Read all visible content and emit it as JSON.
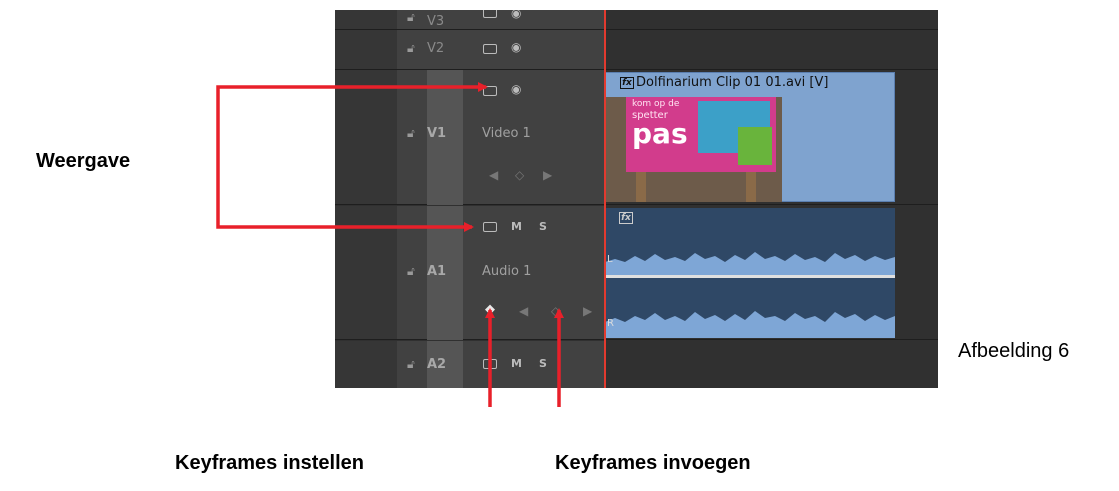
{
  "labels": {
    "weergave": "Weergave",
    "keyframes_set": "Keyframes instellen",
    "keyframes_add": "Keyframes invoegen",
    "figure": "Afbeelding 6"
  },
  "tracks": {
    "v3": {
      "name": "V3"
    },
    "v2": {
      "name": "V2"
    },
    "v1": {
      "name": "V1",
      "label": "Video 1"
    },
    "a1": {
      "name": "A1",
      "label": "Audio 1",
      "mute": "M",
      "solo": "S"
    },
    "a2": {
      "name": "A2",
      "mute": "M",
      "solo": "S"
    }
  },
  "clips": {
    "video_title": "Dolfinarium Clip 01 01.avi [V]",
    "fx_badge": "fx",
    "audio_left": "L",
    "audio_right": "R",
    "poster_line1": "kom op de",
    "poster_line2": "spetter",
    "poster_line3": "pas"
  },
  "colors": {
    "arrow": "#e8202a",
    "playhead": "#e23a2f",
    "video_clip": "#7fa3cf",
    "audio_clip": "#2f4866",
    "waveform": "#7ea6d6"
  }
}
